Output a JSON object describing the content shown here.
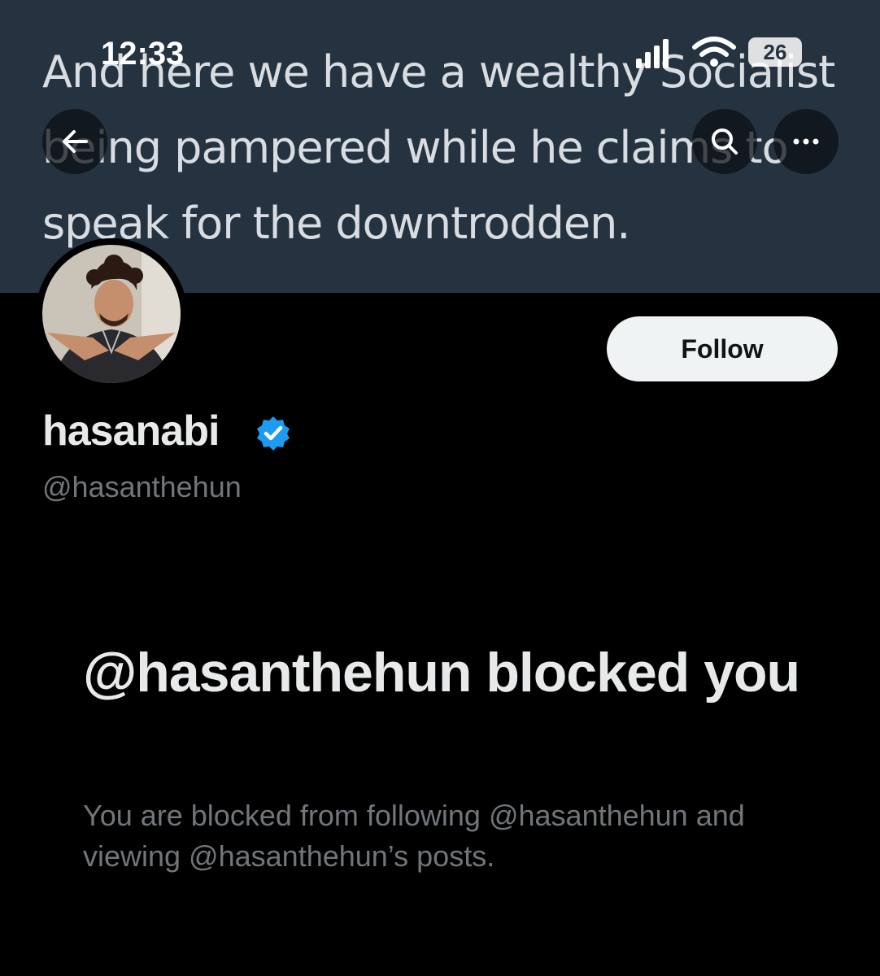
{
  "status_bar": {
    "time": "12:33",
    "battery": "26"
  },
  "banner": {
    "lines": [
      "And here we have a wealthy Socialist",
      "being pampered while he claims to",
      "speak for the downtrodden."
    ]
  },
  "icons": {
    "back": "arrow-left-icon",
    "search": "search-icon",
    "more": "more-horizontal-icon",
    "verified": "verified-badge-icon",
    "signal": "signal-icon",
    "wifi": "wifi-icon"
  },
  "profile": {
    "display_name": "hasanabi",
    "handle": "@hasanthehun",
    "follow_label": "Follow"
  },
  "blocked": {
    "title": "@hasanthehun blocked you",
    "description": "You are blocked from following @hasanthehun and viewing @hasanthehun’s posts."
  },
  "colors": {
    "banner": "#253341",
    "verified": "#1d9bf0",
    "secondary_text": "#71767b",
    "follow_button": "#eff3f4"
  }
}
